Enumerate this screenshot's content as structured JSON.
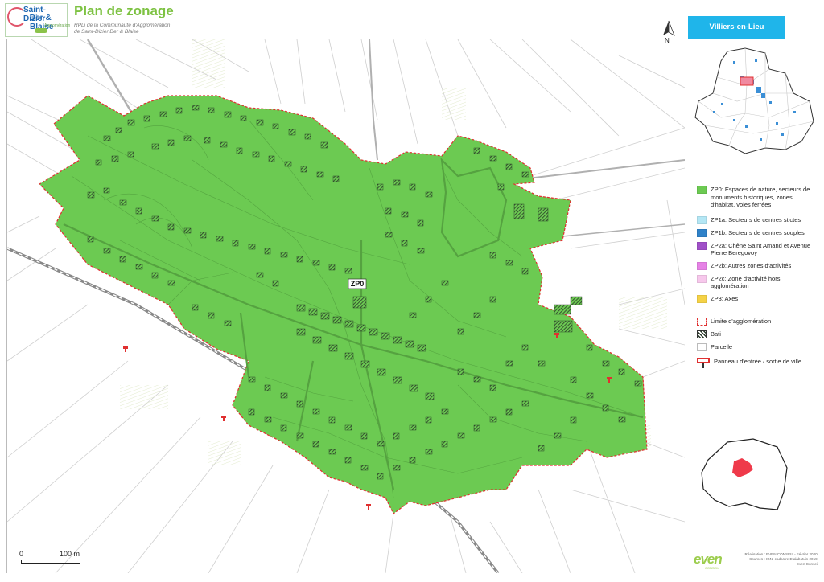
{
  "header": {
    "logo": {
      "line1": "Saint-Dizier",
      "line2": "Der & Blaise",
      "line3": "Agglomération"
    },
    "title": "Plan de zonage",
    "subtitle_line1": "RPLi de la Communauté d'Agglomération",
    "subtitle_line2": "de Saint-Dizier Der & Blaise"
  },
  "map": {
    "zone_label": "ZP0",
    "north_label": "N",
    "scale": {
      "start": "0",
      "end": "100 m"
    },
    "colors": {
      "zp0": "#6cca52",
      "agglo_limit": "#e03030",
      "parcel_line": "#c9c9c9",
      "building_hatch": "#2a3a2a"
    }
  },
  "sidebar": {
    "commune": "Villiers-en-Lieu",
    "legend": [
      {
        "id": "zp0",
        "label": "ZP0: Espaces de nature, secteurs de monuments historiques, zones d'habitat, voies ferrées",
        "color": "#6cca52"
      },
      {
        "id": "zp1a",
        "label": "ZP1a: Secteurs de centres stictes",
        "color": "#b4e7f5"
      },
      {
        "id": "zp1b",
        "label": "ZP1b: Secteurs de centres souples",
        "color": "#2f82c9"
      },
      {
        "id": "zp2a",
        "label": "ZP2a: Chêne Saint Amand et Avenue Pierre Beregovoy",
        "color": "#a050c8"
      },
      {
        "id": "zp2b",
        "label": "ZP2b: Autres zones d'activités",
        "color": "#e682e6"
      },
      {
        "id": "zp2c",
        "label": "ZP2c: Zone d'activité hors agglomération",
        "color": "#f7c8ec"
      },
      {
        "id": "zp3",
        "label": "ZP3: Axes",
        "color": "#f5d246"
      }
    ],
    "legend2": [
      {
        "id": "limit",
        "label": "Limite d'agglomération"
      },
      {
        "id": "bati",
        "label": "Bati"
      },
      {
        "id": "parcelle",
        "label": "Parcelle"
      },
      {
        "id": "panneau",
        "label": "Panneau d'entrée / sortie de ville"
      }
    ]
  },
  "footer": {
    "even_logo": "even",
    "even_sub": "CONSEIL",
    "credit1": "Réalisation : EVEN CONSEIL - Février 2020.",
    "credit2": "Sources : IGN, cadastre Etalab Juin 2019,",
    "credit3": "Even Conseil"
  }
}
